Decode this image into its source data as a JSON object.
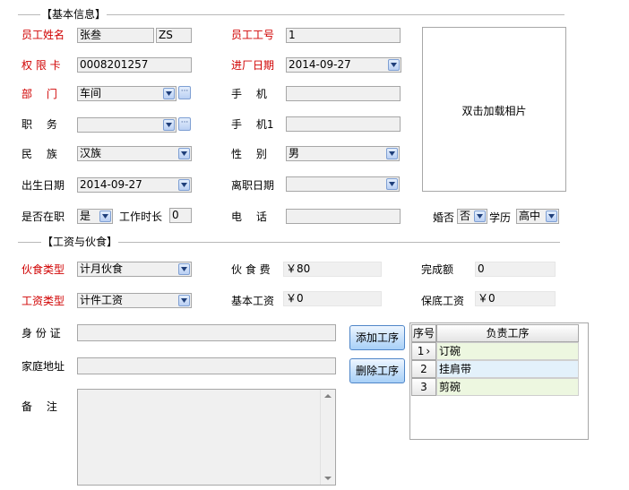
{
  "sections": {
    "basic": "【基本信息】",
    "wage": "【工资与伙食】"
  },
  "fields": {
    "name_label": "员工姓名",
    "name_value": "张叁",
    "name_code": "ZS",
    "emp_no_label": "员工工号",
    "emp_no_value": "1",
    "card_label": "权 限 卡",
    "card_value": "0008201257",
    "entry_date_label": "进厂日期",
    "entry_date_value": "2014-09-27",
    "dept_label": "部　 门",
    "dept_value": "车间",
    "mobile_label": "手　 机",
    "mobile_value": "",
    "position_label": "职　 务",
    "position_value": "",
    "mobile1_label": "手　 机1",
    "mobile1_value": "",
    "ethnic_label": "民　 族",
    "ethnic_value": "汉族",
    "gender_label": "性　 别",
    "gender_value": "男",
    "birth_label": "出生日期",
    "birth_value": "2014-09-27",
    "leave_label": "离职日期",
    "leave_value": "",
    "employed_label": "是否在职",
    "employed_value": "是",
    "tenure_label": "工作时长",
    "tenure_value": "0",
    "phone_label": "电　 话",
    "phone_value": "",
    "married_label": "婚否",
    "married_value": "否",
    "edu_label": "学历",
    "edu_value": "高中",
    "photo_label": "双击加载相片"
  },
  "wage": {
    "meal_type_label": "伙食类型",
    "meal_type_value": "计月伙食",
    "meal_fee_label": "伙 食 费",
    "meal_fee_value": "￥80",
    "done_label": "完成额",
    "done_value": "0",
    "wage_type_label": "工资类型",
    "wage_type_value": "计件工资",
    "base_label": "基本工资",
    "base_value": "￥0",
    "guarantee_label": "保底工资",
    "guarantee_value": "￥0"
  },
  "extra": {
    "id_label": "身 份 证",
    "id_value": "",
    "address_label": "家庭地址",
    "address_value": "",
    "remark_label": "备　 注",
    "remark_value": "",
    "add_btn": "添加工序",
    "del_btn": "删除工序"
  },
  "grid": {
    "col_seq": "序号",
    "col_task": "负责工序",
    "rows": [
      {
        "seq": "1",
        "marker": "›",
        "task": "订碗"
      },
      {
        "seq": "2",
        "marker": "",
        "task": "挂肩带"
      },
      {
        "seq": "3",
        "marker": "",
        "task": "剪碗"
      }
    ]
  },
  "colors": {
    "required_label": "#d00000",
    "row_odd": "#edf7e0",
    "row_selected": "#e3f1fb"
  }
}
